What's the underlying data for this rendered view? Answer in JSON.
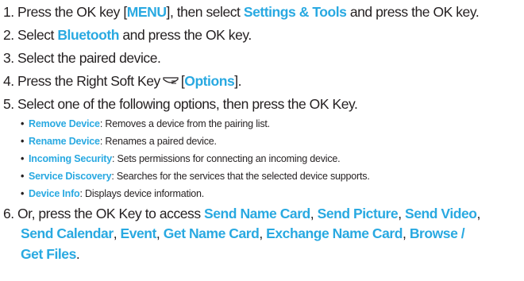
{
  "steps": [
    {
      "number": "1",
      "parts": [
        {
          "text": "Press the OK key ["
        },
        {
          "text": "MENU",
          "hl": true
        },
        {
          "text": "], then select "
        },
        {
          "text": "Settings & Tools",
          "hl": true
        },
        {
          "text": " and press the OK key."
        }
      ]
    },
    {
      "number": "2",
      "parts": [
        {
          "text": "Select "
        },
        {
          "text": "Bluetooth",
          "hl": true
        },
        {
          "text": " and press the OK key."
        }
      ]
    },
    {
      "number": "3",
      "parts": [
        {
          "text": "Select the paired device."
        }
      ]
    },
    {
      "number": "4",
      "parts": [
        {
          "text": "Press the Right Soft Key"
        },
        {
          "icon": "right-soft-key-icon"
        },
        {
          "text": "["
        },
        {
          "text": "Options",
          "hl": true
        },
        {
          "text": "]."
        }
      ]
    },
    {
      "number": "5",
      "parts": [
        {
          "text": "Select one of the following options, then press the OK Key."
        }
      ]
    }
  ],
  "options": [
    {
      "label": "Remove Device",
      "desc": ": Removes a device from the pairing list."
    },
    {
      "label": "Rename Device",
      "desc": ": Renames a paired device."
    },
    {
      "label": "Incoming Security",
      "desc": ": Sets permissions for connecting an incoming device."
    },
    {
      "label": "Service Discovery",
      "desc": ": Searches for the services that the selected device supports."
    },
    {
      "label": "Device Info",
      "desc": ": Displays device information."
    }
  ],
  "bullet_char": "•",
  "step6": {
    "number": "6",
    "lines": [
      [
        {
          "text": "Or, press the OK Key to access "
        },
        {
          "text": "Send Name Card",
          "hl": true
        },
        {
          "text": ", "
        },
        {
          "text": "Send Picture",
          "hl": true
        },
        {
          "text": ", "
        },
        {
          "text": "Send Video",
          "hl": true
        },
        {
          "text": ","
        }
      ],
      [
        {
          "text": "Send Calendar",
          "hl": true
        },
        {
          "text": ", "
        },
        {
          "text": "Event",
          "hl": true
        },
        {
          "text": ", "
        },
        {
          "text": "Get Name Card",
          "hl": true
        },
        {
          "text": ", "
        },
        {
          "text": "Exchange Name Card",
          "hl": true
        },
        {
          "text": ", "
        },
        {
          "text": "Browse /",
          "hl": true
        }
      ],
      [
        {
          "text": "Get Files",
          "hl": true
        },
        {
          "text": "."
        }
      ]
    ]
  },
  "colors": {
    "highlight": "#29a9e1",
    "text": "#231f20"
  }
}
